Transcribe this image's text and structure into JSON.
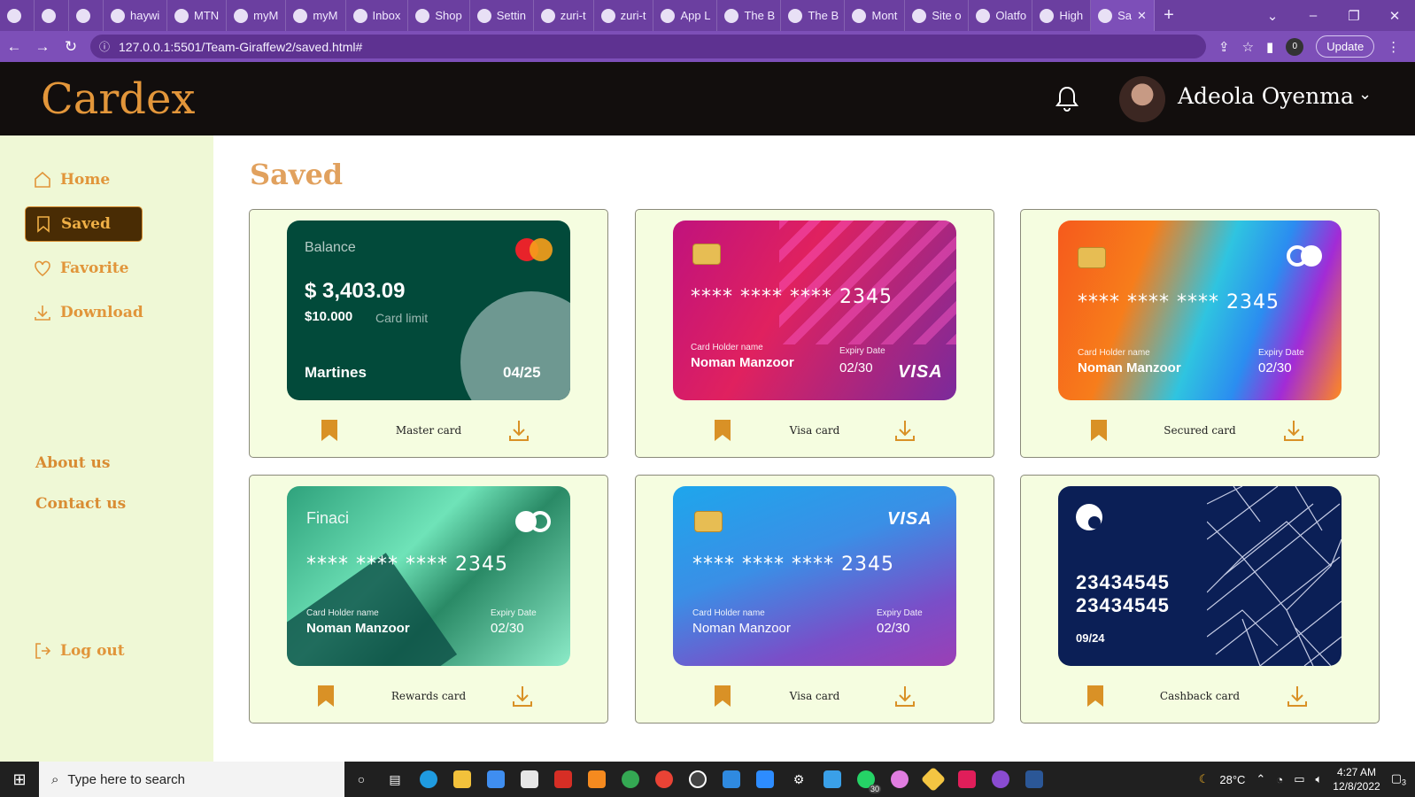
{
  "browser": {
    "tabs": [
      {
        "label": "",
        "icon": "slack-icon"
      },
      {
        "label": "",
        "icon": "slack-icon"
      },
      {
        "label": "",
        "icon": "chrome-icon"
      },
      {
        "label": "haywi",
        "icon": "github-icon"
      },
      {
        "label": "MTN",
        "icon": "mtn-icon"
      },
      {
        "label": "myM",
        "icon": "mtn-icon"
      },
      {
        "label": "myM",
        "icon": "mtn-icon"
      },
      {
        "label": "Inbox",
        "icon": "gmail-icon"
      },
      {
        "label": "Shop",
        "icon": "k-icon"
      },
      {
        "label": "Settin",
        "icon": "k-icon"
      },
      {
        "label": "zuri-t",
        "icon": "github-icon"
      },
      {
        "label": "zuri-t",
        "icon": "github-icon"
      },
      {
        "label": "App L",
        "icon": "globe-icon"
      },
      {
        "label": "The B",
        "icon": "globe-icon"
      },
      {
        "label": "The B",
        "icon": "globe-icon"
      },
      {
        "label": "Mont",
        "icon": "monday-icon"
      },
      {
        "label": "Site o",
        "icon": "diamond-icon"
      },
      {
        "label": "Olatfo",
        "icon": "globe-icon"
      },
      {
        "label": "High",
        "icon": "figma-icon"
      },
      {
        "label": "Sa",
        "icon": "globe-icon",
        "active": true
      }
    ],
    "url": "127.0.0.1:5501/Team-Giraffew2/saved.html#",
    "update_label": "Update",
    "profile_count": "0"
  },
  "header": {
    "logo": "Cardex",
    "user_name": "Adeola Oyenma"
  },
  "sidebar": {
    "items": [
      {
        "label": "Home",
        "icon": "home-icon"
      },
      {
        "label": "Saved",
        "icon": "bookmark-icon",
        "active": true
      },
      {
        "label": "Favorite",
        "icon": "heart-icon"
      },
      {
        "label": "Download",
        "icon": "download-icon"
      }
    ],
    "about": "About us",
    "contact": "Contact us",
    "logout": "Log out"
  },
  "main": {
    "title": "Saved",
    "cards": [
      {
        "label": "Master card",
        "style": "green-balance",
        "balance_label": "Balance",
        "balance": "$ 3,403.09",
        "limit": "$10.000",
        "limit_label": "Card limit",
        "holder": "Martines",
        "expiry": "04/25"
      },
      {
        "label": "Visa card",
        "style": "magenta",
        "number": "**** **** **** 2345",
        "holder_label": "Card Holder name",
        "holder": "Noman Manzoor",
        "expiry_label": "Expiry Date",
        "expiry": "02/30",
        "brand": "VISA"
      },
      {
        "label": "Secured card",
        "style": "rainbow",
        "number": "**** **** **** 2345",
        "holder_label": "Card Holder name",
        "holder": "Noman Manzoor",
        "expiry_label": "Expiry Date",
        "expiry": "02/30"
      },
      {
        "label": "Rewards card",
        "style": "teal",
        "brand_name": "Finaci",
        "number": "**** **** **** 2345",
        "holder_label": "Card Holder name",
        "holder": "Noman Manzoor",
        "expiry_label": "Expiry Date",
        "expiry": "02/30"
      },
      {
        "label": "Visa card",
        "style": "blue-purple",
        "number": "**** **** **** 2345",
        "holder_label": "Card Holder name",
        "holder": "Noman Manzoor",
        "expiry_label": "Expiry Date",
        "expiry": "02/30",
        "brand": "VISA"
      },
      {
        "label": "Cashback card",
        "style": "navy-geometric",
        "number_line1": "23434545",
        "number_line2": "23434545",
        "expiry": "09/24"
      }
    ]
  },
  "taskbar": {
    "search_placeholder": "Type here to search",
    "weather": "28°C",
    "time": "4:27 AM",
    "date": "12/8/2022",
    "notification_count": "3",
    "whatsapp_badge": "30"
  },
  "colors": {
    "brand": "#e3963a",
    "header_bg": "#120e0d",
    "sidebar_bg": "#eff8d6",
    "card_panel": "#f5fde0",
    "bookmark": "#d99126"
  }
}
